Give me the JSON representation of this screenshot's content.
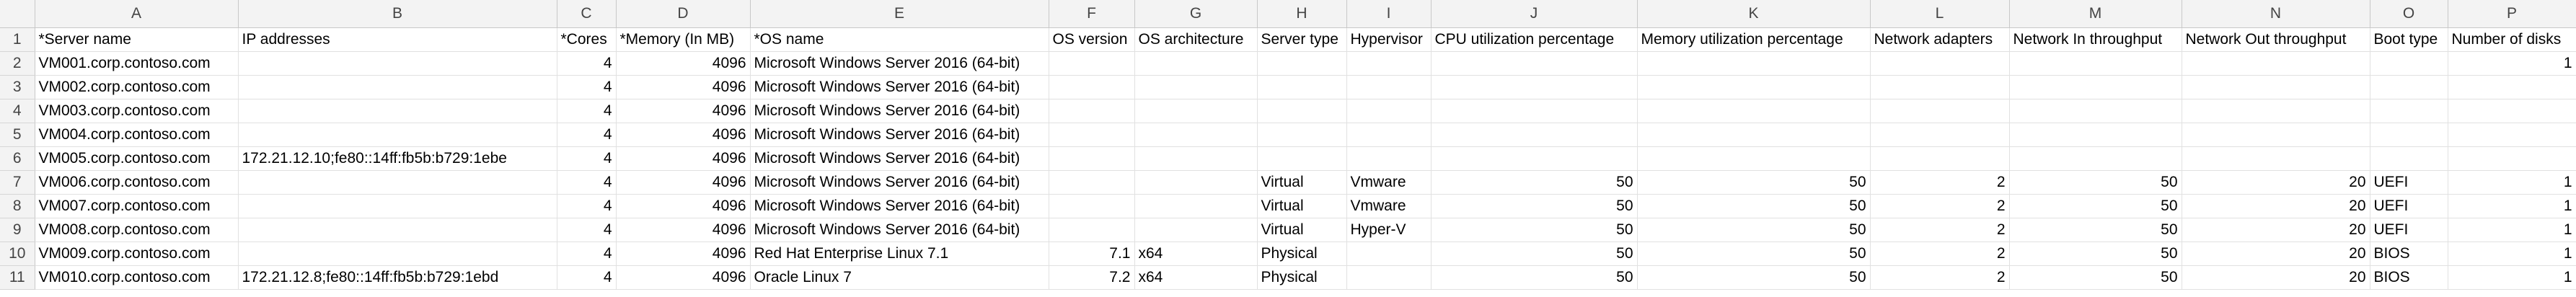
{
  "columns": [
    "A",
    "B",
    "C",
    "D",
    "E",
    "F",
    "G",
    "H",
    "I",
    "J",
    "K",
    "L",
    "M",
    "N",
    "O",
    "P"
  ],
  "numeric_columns": [
    2,
    3,
    5,
    9,
    10,
    11,
    12,
    13,
    15
  ],
  "rows": [
    [
      "*Server name",
      "IP addresses",
      "*Cores",
      "*Memory (In MB)",
      "*OS name",
      "OS version",
      "OS architecture",
      "Server type",
      "Hypervisor",
      "CPU utilization percentage",
      "Memory utilization percentage",
      "Network adapters",
      "Network In throughput",
      "Network Out throughput",
      "Boot type",
      "Number of disks"
    ],
    [
      "VM001.corp.contoso.com",
      "",
      "4",
      "4096",
      "Microsoft Windows Server 2016 (64-bit)",
      "",
      "",
      "",
      "",
      "",
      "",
      "",
      "",
      "",
      "",
      "1"
    ],
    [
      "VM002.corp.contoso.com",
      "",
      "4",
      "4096",
      "Microsoft Windows Server 2016 (64-bit)",
      "",
      "",
      "",
      "",
      "",
      "",
      "",
      "",
      "",
      "",
      ""
    ],
    [
      "VM003.corp.contoso.com",
      "",
      "4",
      "4096",
      "Microsoft Windows Server 2016 (64-bit)",
      "",
      "",
      "",
      "",
      "",
      "",
      "",
      "",
      "",
      "",
      ""
    ],
    [
      "VM004.corp.contoso.com",
      "",
      "4",
      "4096",
      "Microsoft Windows Server 2016 (64-bit)",
      "",
      "",
      "",
      "",
      "",
      "",
      "",
      "",
      "",
      "",
      ""
    ],
    [
      "VM005.corp.contoso.com",
      "172.21.12.10;fe80::14ff:fb5b:b729:1ebe",
      "4",
      "4096",
      "Microsoft Windows Server 2016 (64-bit)",
      "",
      "",
      "",
      "",
      "",
      "",
      "",
      "",
      "",
      "",
      ""
    ],
    [
      "VM006.corp.contoso.com",
      "",
      "4",
      "4096",
      "Microsoft Windows Server 2016 (64-bit)",
      "",
      "",
      "Virtual",
      "Vmware",
      "50",
      "50",
      "2",
      "50",
      "20",
      "UEFI",
      "1"
    ],
    [
      "VM007.corp.contoso.com",
      "",
      "4",
      "4096",
      "Microsoft Windows Server 2016 (64-bit)",
      "",
      "",
      "Virtual",
      "Vmware",
      "50",
      "50",
      "2",
      "50",
      "20",
      "UEFI",
      "1"
    ],
    [
      "VM008.corp.contoso.com",
      "",
      "4",
      "4096",
      "Microsoft Windows Server 2016 (64-bit)",
      "",
      "",
      "Virtual",
      "Hyper-V",
      "50",
      "50",
      "2",
      "50",
      "20",
      "UEFI",
      "1"
    ],
    [
      "VM009.corp.contoso.com",
      "",
      "4",
      "4096",
      "Red Hat Enterprise Linux 7.1",
      "7.1",
      "x64",
      "Physical",
      "",
      "50",
      "50",
      "2",
      "50",
      "20",
      "BIOS",
      "1"
    ],
    [
      "VM010.corp.contoso.com",
      "172.21.12.8;fe80::14ff:fb5b:b729:1ebd",
      "4",
      "4096",
      "Oracle Linux 7",
      "7.2",
      "x64",
      "Physical",
      "",
      "50",
      "50",
      "2",
      "50",
      "20",
      "BIOS",
      "1"
    ]
  ]
}
